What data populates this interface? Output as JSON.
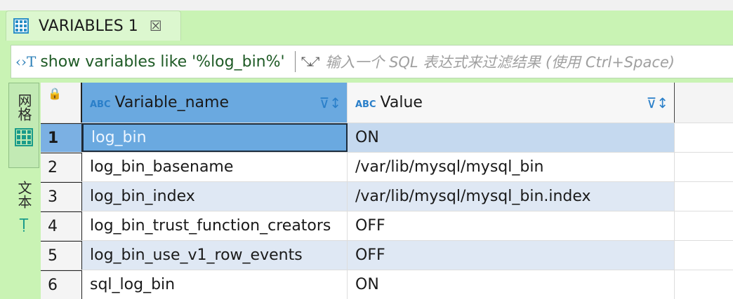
{
  "tab": {
    "title": "VARIABLES 1",
    "close": "☒"
  },
  "filter": {
    "query": "show variables like '%log_bin%'",
    "placeholder": "输入一个 SQL 表达式来过滤结果 (使用 Ctrl+Space)"
  },
  "side": {
    "grid_label": "网格",
    "text_label": "文本"
  },
  "table": {
    "columns": [
      "Variable_name",
      "Value"
    ],
    "type_badge": "ABC",
    "rows": [
      {
        "n": "1",
        "name": "log_bin",
        "value": "ON"
      },
      {
        "n": "2",
        "name": "log_bin_basename",
        "value": "/var/lib/mysql/mysql_bin"
      },
      {
        "n": "3",
        "name": "log_bin_index",
        "value": "/var/lib/mysql/mysql_bin.index"
      },
      {
        "n": "4",
        "name": "log_bin_trust_function_creators",
        "value": "OFF"
      },
      {
        "n": "5",
        "name": "log_bin_use_v1_row_events",
        "value": "OFF"
      },
      {
        "n": "6",
        "name": "sql_log_bin",
        "value": "ON"
      }
    ]
  }
}
